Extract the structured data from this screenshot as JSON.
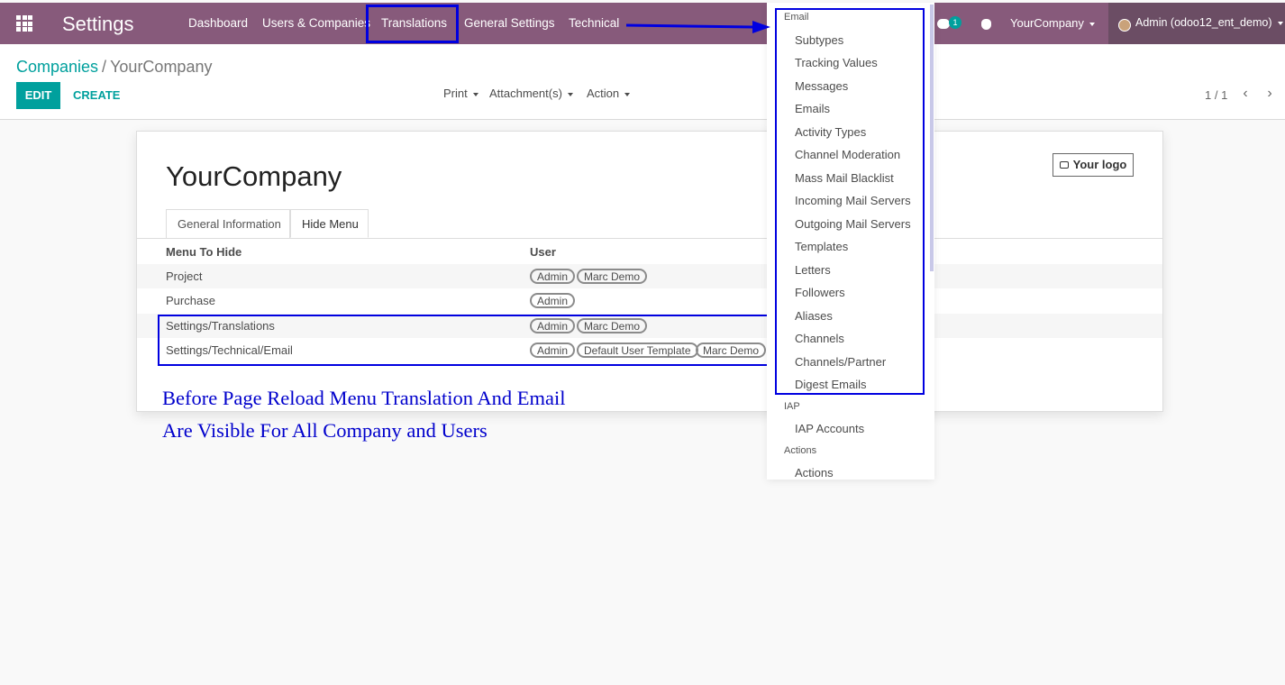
{
  "app": {
    "title": "Settings"
  },
  "nav": {
    "items": [
      "Dashboard",
      "Users & Companies",
      "Translations",
      "General Settings",
      "Technical"
    ]
  },
  "systray": {
    "chat_count": "1",
    "company": "YourCompany",
    "user": "Admin (odoo12_ent_demo)"
  },
  "breadcrumb": {
    "parent": "Companies",
    "separator": "/",
    "current": "YourCompany"
  },
  "buttons": {
    "edit": "EDIT",
    "create": "CREATE"
  },
  "sidebar": {
    "print": "Print",
    "attachments": "Attachment(s)",
    "action": "Action"
  },
  "pager": {
    "value": "1 / 1"
  },
  "record": {
    "name": "YourCompany",
    "logo_label": "Your logo",
    "tabs": [
      "General Information",
      "Hide Menu"
    ],
    "columns": {
      "menu": "Menu To Hide",
      "user": "User"
    },
    "rows": [
      {
        "menu": "Project",
        "users": [
          "Admin",
          "Marc Demo"
        ]
      },
      {
        "menu": "Purchase",
        "users": [
          "Admin"
        ]
      },
      {
        "menu": "Settings/Translations",
        "users": [
          "Admin",
          "Marc Demo"
        ]
      },
      {
        "menu": "Settings/Technical/Email",
        "users": [
          "Admin",
          "Default User Template",
          "Marc Demo"
        ]
      }
    ]
  },
  "annotation": {
    "line1": "Before Page Reload Menu Translation And Email",
    "line2": "Are Visible For All Company and Users"
  },
  "dropdown": {
    "sections": [
      {
        "header": "Email",
        "items": [
          "Subtypes",
          "Tracking Values",
          "Messages",
          "Emails",
          "Activity Types",
          "Channel Moderation",
          "Mass Mail Blacklist",
          "Incoming Mail Servers",
          "Outgoing Mail Servers",
          "Templates",
          "Letters",
          "Followers",
          "Aliases",
          "Channels",
          "Channels/Partner",
          "Digest Emails"
        ]
      },
      {
        "header": "IAP",
        "items": [
          "IAP Accounts"
        ]
      },
      {
        "header": "Actions",
        "items": [
          "Actions"
        ]
      }
    ]
  },
  "colors": {
    "topbar": "#875a7b",
    "accent": "#00a09d",
    "highlight": "#0000e0"
  }
}
